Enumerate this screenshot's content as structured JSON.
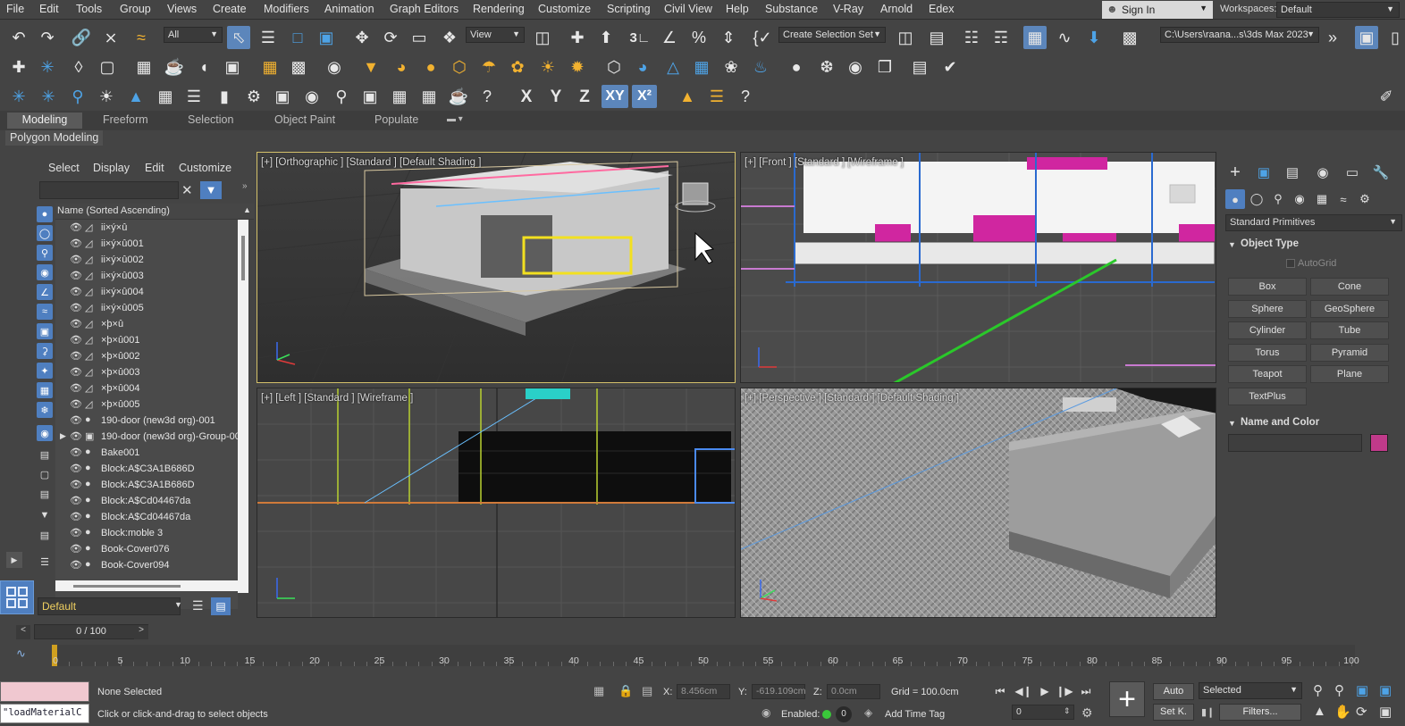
{
  "menubar": {
    "items": [
      "File",
      "Edit",
      "Tools",
      "Group",
      "Views",
      "Create",
      "Modifiers",
      "Animation",
      "Graph Editors",
      "Rendering",
      "Customize",
      "Scripting",
      "Civil View",
      "Help",
      "Substance",
      "V-Ray",
      "Arnold",
      "Edex"
    ],
    "sign_in": "Sign In",
    "workspaces_label": "Workspaces:",
    "workspace_value": "Default"
  },
  "main_toolbar": {
    "selection_filter": "All",
    "ref_coord": "View",
    "named_selection": "Create Selection Set",
    "project_path": "C:\\Users\\raana...s\\3ds Max 2023"
  },
  "axis_toolbar": {
    "x": "X",
    "y": "Y",
    "z": "Z",
    "xy": "XY",
    "xz": "X²"
  },
  "ribbon": {
    "tabs": [
      "Modeling",
      "Freeform",
      "Selection",
      "Object Paint",
      "Populate"
    ],
    "active_tab": "Modeling",
    "panel": "Polygon Modeling"
  },
  "scene_explorer": {
    "menu": [
      "Select",
      "Display",
      "Edit",
      "Customize"
    ],
    "column_header": "Name (Sorted Ascending)",
    "rows": [
      {
        "name": "ii×ý×û",
        "icon": "bone"
      },
      {
        "name": "ii×ý×û001",
        "icon": "bone"
      },
      {
        "name": "ii×ý×û002",
        "icon": "bone"
      },
      {
        "name": "ii×ý×û003",
        "icon": "bone"
      },
      {
        "name": "ii×ý×û004",
        "icon": "bone"
      },
      {
        "name": "ii×ý×û005",
        "icon": "bone"
      },
      {
        "name": "×þ×û",
        "icon": "bone"
      },
      {
        "name": "×þ×û001",
        "icon": "bone"
      },
      {
        "name": "×þ×û002",
        "icon": "bone"
      },
      {
        "name": "×þ×û003",
        "icon": "bone"
      },
      {
        "name": "×þ×û004",
        "icon": "bone"
      },
      {
        "name": "×þ×û005",
        "icon": "bone"
      },
      {
        "name": "190-door (new3d org)-001",
        "icon": "geometry"
      },
      {
        "name": "190-door (new3d org)-Group-00",
        "icon": "group"
      },
      {
        "name": "Bake001",
        "icon": "geometry"
      },
      {
        "name": "Block:A$C3A1B686D",
        "icon": "geometry"
      },
      {
        "name": "Block:A$C3A1B686D",
        "icon": "geometry"
      },
      {
        "name": "Block:A$Cd04467da",
        "icon": "geometry"
      },
      {
        "name": "Block:A$Cd04467da",
        "icon": "geometry"
      },
      {
        "name": "Block:moble 3",
        "icon": "geometry"
      },
      {
        "name": "Book-Cover076",
        "icon": "geometry"
      },
      {
        "name": "Book-Cover094",
        "icon": "geometry"
      }
    ],
    "layer": "Default"
  },
  "viewports": {
    "top_left": "[+] [Orthographic ] [Standard ] [Default Shading ]",
    "top_right": "[+] [Front ] [Standard ] [Wireframe ]",
    "bottom_left": "[+] [Left ] [Standard ] [Wireframe ]",
    "bottom_right": "[+] [Perspective ] [Standard ] [Default Shading ]"
  },
  "command_panel": {
    "category": "Standard Primitives",
    "object_type_title": "Object Type",
    "autogrid": "AutoGrid",
    "buttons": [
      "Box",
      "Cone",
      "Sphere",
      "GeoSphere",
      "Cylinder",
      "Tube",
      "Torus",
      "Pyramid",
      "Teapot",
      "Plane",
      "TextPlus"
    ],
    "name_color_title": "Name and Color",
    "object_color": "#c03a8a"
  },
  "timeline": {
    "frame": "0 / 100",
    "labels": [
      "0",
      "5",
      "10",
      "15",
      "20",
      "25",
      "30",
      "35",
      "40",
      "45",
      "50",
      "55",
      "60",
      "65",
      "70",
      "75",
      "80",
      "85",
      "90",
      "95",
      "100"
    ]
  },
  "status": {
    "maxscript_input": "\"loadMaterialC",
    "selection": "None Selected",
    "prompt": "Click or click-and-drag to select objects",
    "x_label": "X:",
    "x_value": "8.456cm",
    "y_label": "Y:",
    "y_value": "-619.109cm",
    "z_label": "Z:",
    "z_value": "0.0cm",
    "grid": "Grid = 100.0cm",
    "enabled": "Enabled:",
    "add_time_tag": "Add Time Tag",
    "auto": "Auto",
    "set_key": "Set K.",
    "key_filter": "Selected",
    "filters": "Filters...",
    "current_frame": "0"
  }
}
